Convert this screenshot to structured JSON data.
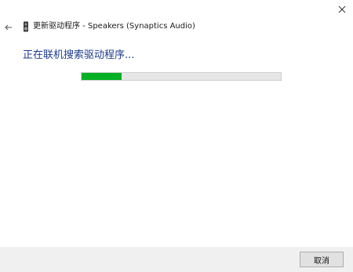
{
  "window": {
    "title": "更新驱动程序 - Speakers (Synaptics Audio)"
  },
  "icons": {
    "close": "close-icon",
    "back": "back-arrow-icon",
    "device": "speaker-device-icon"
  },
  "status": {
    "heading": "正在联机搜索驱动程序..."
  },
  "progress": {
    "fraction": 0.2,
    "fill_color": "#06b025",
    "track_color": "#e6e6e6"
  },
  "footer": {
    "cancel_label": "取消"
  },
  "colors": {
    "heading": "#1b3a8c",
    "footer_bg": "#f0f0f0"
  }
}
